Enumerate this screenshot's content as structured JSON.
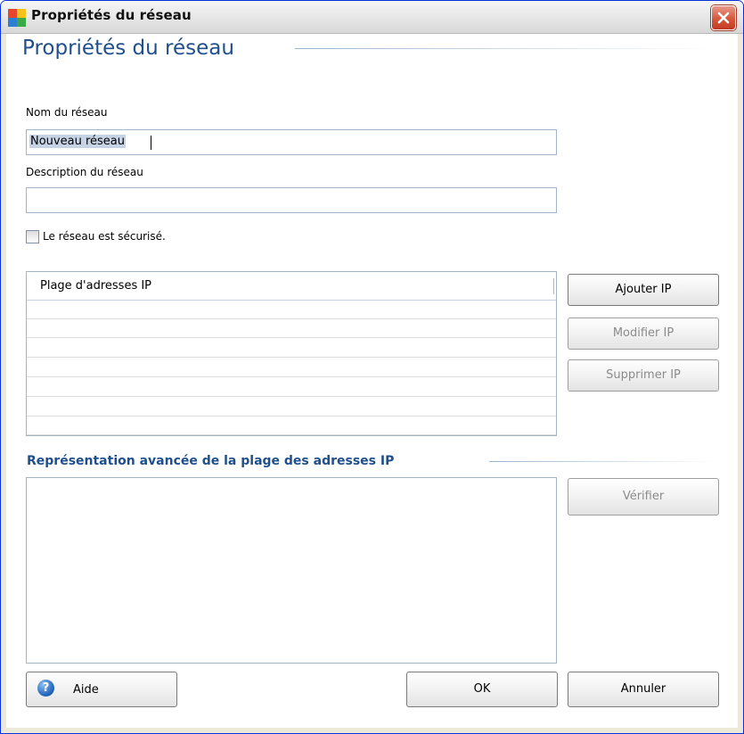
{
  "window": {
    "title": "Propriétés du réseau"
  },
  "header": {
    "title": "Propriétés du réseau"
  },
  "fields": {
    "name_label": "Nom du réseau",
    "name_value": "Nouveau réseau",
    "description_label": "Description du réseau",
    "description_value": "",
    "secured_label": "Le réseau est sécurisé.",
    "secured_checked": false
  },
  "ip_list": {
    "column_header": "Plage d'adresses IP",
    "rows": []
  },
  "ip_buttons": {
    "add": "Ajouter IP",
    "edit": "Modifier IP",
    "delete": "Supprimer IP"
  },
  "advanced": {
    "title": "Représentation avancée de la plage des adresses IP",
    "value": "",
    "verify": "Vérifier"
  },
  "footer": {
    "help": "Aide",
    "ok": "OK",
    "cancel": "Annuler"
  },
  "icons": {
    "app": "network-properties-icon",
    "close": "close-icon",
    "help": "help-icon"
  },
  "colors": {
    "heading": "#1f4f8c",
    "close_button": "#d6573c"
  }
}
